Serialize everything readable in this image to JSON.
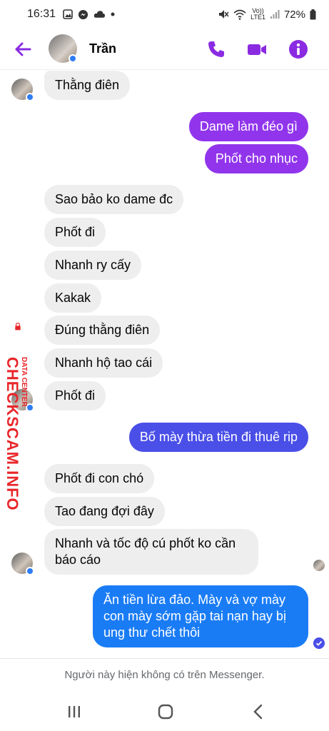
{
  "status_bar": {
    "time": "16:31",
    "battery": "72%",
    "net_top": "Vo))",
    "net_bottom": "LTE1"
  },
  "header": {
    "contact_name": "Trần"
  },
  "messages": [
    {
      "text": "Thằng điên"
    },
    {
      "text": "Dame làm đéo gì"
    },
    {
      "text": "Phốt cho nhục"
    },
    {
      "text": "Sao bảo ko dame đc"
    },
    {
      "text": "Phốt đi"
    },
    {
      "text": "Nhanh ry cấy"
    },
    {
      "text": "Kakak"
    },
    {
      "text": "Đúng thằng điên"
    },
    {
      "text": "Nhanh hộ tao cái"
    },
    {
      "text": "Phốt đi"
    },
    {
      "text": "Bố mày thừa tiền đi thuê rip"
    },
    {
      "text": "Phốt đi con chó"
    },
    {
      "text": "Tao đang đợi đây"
    },
    {
      "text": "Nhanh và tốc độ cú phốt ko cần báo cáo"
    },
    {
      "text": "Ăn tiền lừa đảo. Mày và vợ mày con mày sớm gặp tai nạn hay bị ung thư chết thôi"
    }
  ],
  "watermark": {
    "main": "CHECKSCAM.INFO",
    "small": "DATA CENTER"
  },
  "footer": {
    "notice": "Người này hiện không có trên Messenger."
  },
  "colors": {
    "accent": "#8a2be2",
    "incoming_bubble": "#eeeeee",
    "outgoing_purple": "#9135ec",
    "outgoing_indigo": "#4a4fe8",
    "outgoing_blue": "#1a7cf5",
    "watermark": "#e8262a"
  },
  "icons": [
    "back-arrow-icon",
    "phone-icon",
    "video-camera-icon",
    "info-icon",
    "recents-icon",
    "home-icon",
    "nav-back-icon"
  ]
}
